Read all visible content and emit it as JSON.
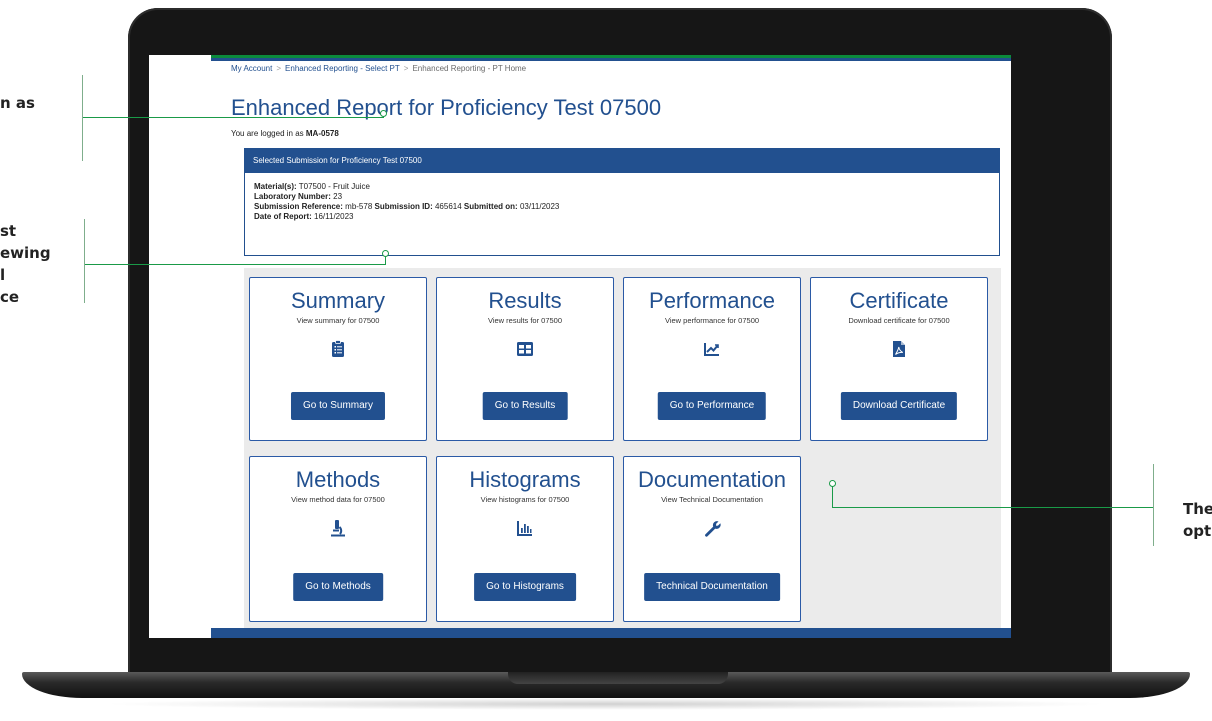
{
  "breadcrumb": {
    "my_account": "My Account",
    "select_pt": "Enhanced Reporting - Select PT",
    "pt_home": "Enhanced Reporting - PT Home",
    "separator": ">"
  },
  "page": {
    "title": "Enhanced Report for Proficiency Test 07500",
    "login_prefix": "You are logged in as",
    "login_user": "MA-0578"
  },
  "submission": {
    "header": "Selected Submission for Proficiency Test 07500",
    "material_label": "Material(s):",
    "material_value": "T07500 - Fruit Juice",
    "lab_label": "Laboratory Number:",
    "lab_value": "23",
    "ref_label": "Submission Reference:",
    "ref_value": "mb-578",
    "id_label": "Submission ID:",
    "id_value": "465614",
    "submitted_label": "Submitted on:",
    "submitted_value": "03/11/2023",
    "report_date_label": "Date of Report:",
    "report_date_value": "16/11/2023"
  },
  "cards": [
    {
      "title": "Summary",
      "subtitle": "View summary for 07500",
      "button": "Go to Summary",
      "icon": "clipboard-list-icon"
    },
    {
      "title": "Results",
      "subtitle": "View results for 07500",
      "button": "Go to Results",
      "icon": "table-icon"
    },
    {
      "title": "Performance",
      "subtitle": "View performance for 07500",
      "button": "Go to Performance",
      "icon": "chart-line-icon"
    },
    {
      "title": "Certificate",
      "subtitle": "Download certificate for 07500",
      "button": "Download Certificate",
      "icon": "pdf-file-icon"
    },
    {
      "title": "Methods",
      "subtitle": "View method data for 07500",
      "button": "Go to Methods",
      "icon": "microscope-icon"
    },
    {
      "title": "Histograms",
      "subtitle": "View histograms for 07500",
      "button": "Go to Histograms",
      "icon": "bar-chart-icon"
    },
    {
      "title": "Documentation",
      "subtitle": "View Technical Documentation",
      "button": "Technical Documentation",
      "icon": "wrench-icon"
    }
  ],
  "callouts": {
    "left_top": [
      "n as"
    ],
    "left_middle": [
      "st",
      "ewing",
      "l",
      "ce"
    ],
    "right": [
      "The",
      "opt"
    ]
  },
  "colors": {
    "brand_blue": "#22508f",
    "accent_green": "#0b8a3c",
    "grid_background": "#ebebeb"
  }
}
